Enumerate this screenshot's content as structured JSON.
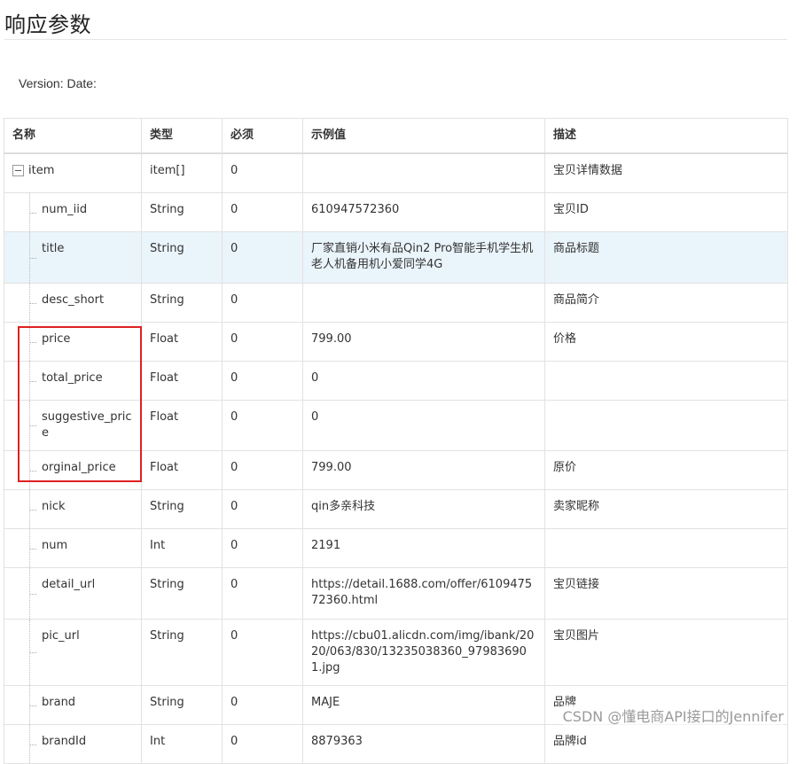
{
  "page": {
    "title": "响应参数",
    "version_text": "Version: Date:"
  },
  "table": {
    "headers": [
      "名称",
      "类型",
      "必须",
      "示例值",
      "描述"
    ],
    "rows": [
      {
        "name": "item",
        "type": "item[]",
        "required": "0",
        "example": "",
        "desc": "宝贝详情数据"
      },
      {
        "name": "num_iid",
        "type": "String",
        "required": "0",
        "example": "610947572360",
        "desc": "宝贝ID"
      },
      {
        "name": "title",
        "type": "String",
        "required": "0",
        "example": "厂家直销小米有品Qin2 Pro智能手机学生机老人机备用机小爱同学4G",
        "desc": "商品标题"
      },
      {
        "name": "desc_short",
        "type": "String",
        "required": "0",
        "example": "",
        "desc": "商品简介"
      },
      {
        "name": "price",
        "type": "Float",
        "required": "0",
        "example": "799.00",
        "desc": "价格"
      },
      {
        "name": "total_price",
        "type": "Float",
        "required": "0",
        "example": "0",
        "desc": ""
      },
      {
        "name": "suggestive_price",
        "type": "Float",
        "required": "0",
        "example": "0",
        "desc": ""
      },
      {
        "name": "orginal_price",
        "type": "Float",
        "required": "0",
        "example": "799.00",
        "desc": "原价"
      },
      {
        "name": "nick",
        "type": "String",
        "required": "0",
        "example": "qin多亲科技",
        "desc": "卖家昵称"
      },
      {
        "name": "num",
        "type": "Int",
        "required": "0",
        "example": "2191",
        "desc": ""
      },
      {
        "name": "detail_url",
        "type": "String",
        "required": "0",
        "example": "https://detail.1688.com/offer/610947572360.html",
        "desc": "宝贝链接"
      },
      {
        "name": "pic_url",
        "type": "String",
        "required": "0",
        "example": "https://cbu01.alicdn.com/img/ibank/2020/063/830/13235038360_979836901.jpg",
        "desc": "宝贝图片"
      },
      {
        "name": "brand",
        "type": "String",
        "required": "0",
        "example": "MAJE",
        "desc": "品牌"
      },
      {
        "name": "brandId",
        "type": "Int",
        "required": "0",
        "example": "8879363",
        "desc": "品牌id"
      }
    ]
  },
  "watermark": "CSDN @懂电商API接口的Jennifer",
  "colors": {
    "highlight_row": "#eaf4fb",
    "annotation_box": "#e02020",
    "border": "#e2e2e2"
  }
}
